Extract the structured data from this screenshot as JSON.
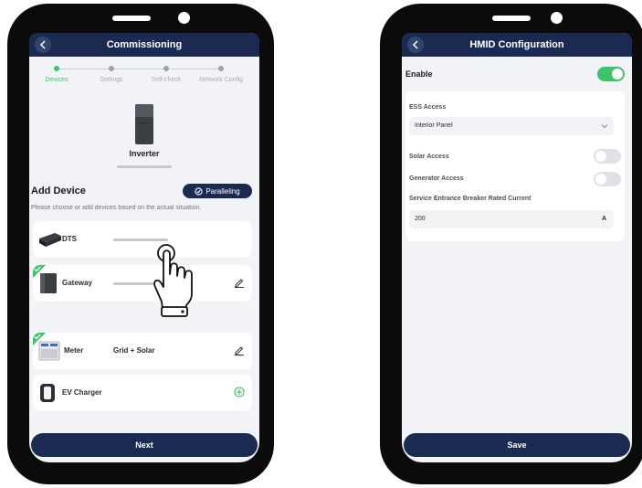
{
  "left_phone": {
    "title": "Commissioning",
    "steps": [
      "Devices",
      "Settings",
      "Self-check",
      "Network Config"
    ],
    "active_step": 0,
    "inverter_label": "Inverter",
    "add_device_heading": "Add Device",
    "paralleling_button": "Paralleling",
    "hint": "Please choose or add devices based on the actual situation.",
    "devices": [
      {
        "name": "DTS",
        "value": "",
        "icon": "dts-icon",
        "action": "none",
        "checked": false
      },
      {
        "name": "Gateway",
        "value": "",
        "icon": "gateway-icon",
        "action": "edit",
        "checked": true
      },
      {
        "name": "Meter",
        "value": "Grid + Solar",
        "icon": "meter-icon",
        "action": "edit",
        "checked": true
      },
      {
        "name": "EV Charger",
        "value": "",
        "icon": "ev-charger-icon",
        "action": "add",
        "checked": false
      }
    ],
    "next_button": "Next"
  },
  "right_phone": {
    "title": "HMID Configuration",
    "enable_label": "Enable",
    "enable_on": true,
    "ess_access_label": "ESS Access",
    "ess_access_value": "Interior Panel",
    "solar_access_label": "Solar Access",
    "solar_access_on": false,
    "generator_access_label": "Generator Access",
    "generator_access_on": false,
    "breaker_label": "Service Entrance Breaker Rated Current",
    "breaker_value": "200",
    "breaker_unit": "A",
    "save_button": "Save"
  },
  "colors": {
    "navy": "#1a2a52",
    "green": "#3bc46a",
    "screen_bg": "#f2f3f6"
  }
}
